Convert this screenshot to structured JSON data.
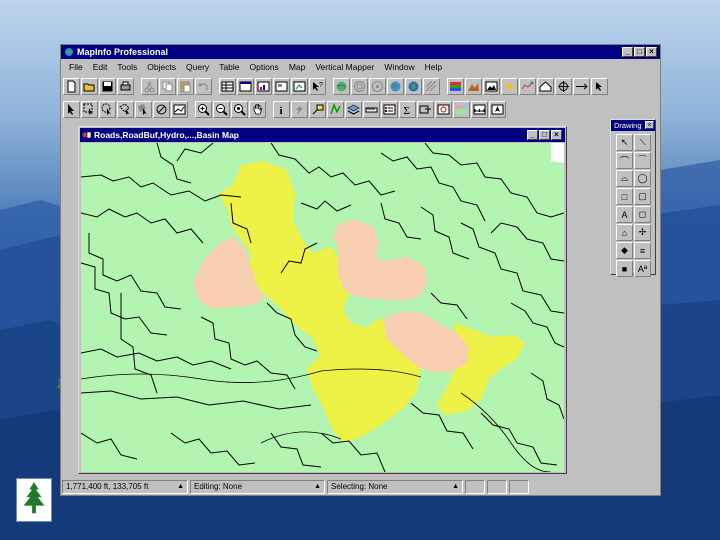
{
  "app": {
    "title": "MapInfo Professional",
    "controls": {
      "minimize": "_",
      "maximize": "□",
      "close": "×"
    }
  },
  "menu": [
    "File",
    "Edit",
    "Tools",
    "Objects",
    "Query",
    "Table",
    "Options",
    "Map",
    "Vertical Mapper",
    "Window",
    "Help"
  ],
  "map_window": {
    "title": "Roads,RoadBuf,Hydro,...,Basin Map",
    "controls": {
      "minimize": "_",
      "maximize": "□",
      "close": "×"
    },
    "colors": {
      "background": "#b3f5b0",
      "buffer": "#eef246",
      "basin": "#f8cfb1",
      "roads": "#000000"
    }
  },
  "drawing_palette": {
    "title": "Drawing",
    "close": "×",
    "tools": [
      {
        "glyph": "↖",
        "icon": "select-icon"
      },
      {
        "glyph": "⟍",
        "icon": "line-icon"
      },
      {
        "glyph": "⌒",
        "icon": "polyline-icon"
      },
      {
        "glyph": "⁀",
        "icon": "arc-icon"
      },
      {
        "glyph": "⌓",
        "icon": "polygon-icon"
      },
      {
        "glyph": "◯",
        "icon": "ellipse-icon"
      },
      {
        "glyph": "□",
        "icon": "rectangle-icon"
      },
      {
        "glyph": "▢",
        "icon": "rounded-rectangle-icon"
      },
      {
        "glyph": "A",
        "icon": "text-icon"
      },
      {
        "glyph": "◻",
        "icon": "frame-icon"
      },
      {
        "glyph": "⌂",
        "icon": "reshape-icon"
      },
      {
        "glyph": "✢",
        "icon": "add-node-icon"
      },
      {
        "glyph": "◆",
        "icon": "symbol-style-icon"
      },
      {
        "glyph": "≡",
        "icon": "line-style-icon"
      },
      {
        "glyph": "■",
        "icon": "region-style-icon"
      },
      {
        "glyph": "Aª",
        "icon": "text-style-icon"
      }
    ]
  },
  "status": {
    "zoom": "1,771,400 ft, 133,705 ft",
    "editing": "Editing: None",
    "selecting": "Selecting: None",
    "arrow": "▲"
  }
}
